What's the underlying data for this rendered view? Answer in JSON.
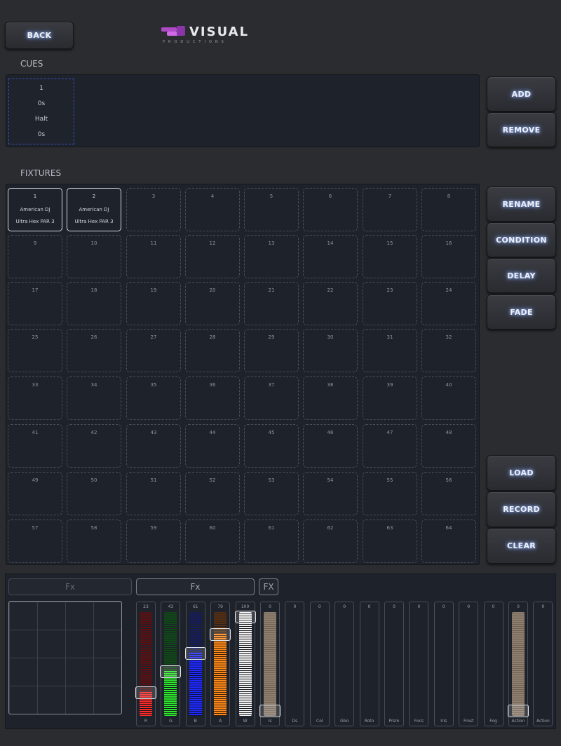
{
  "header": {
    "back_label": "BACK",
    "logo_text": "VISUAL",
    "logo_sub": "PRODUCTIONS"
  },
  "cues": {
    "title": "CUES",
    "items": [
      {
        "number": "1",
        "time": "0s",
        "action": "Halt",
        "fade": "0s"
      }
    ],
    "add_label": "ADD",
    "remove_label": "REMOVE"
  },
  "fixtures": {
    "title": "FIXTURES",
    "actions": [
      "RENAME",
      "CONDITION",
      "DELAY",
      "FADE"
    ],
    "bottom_actions": [
      "LOAD",
      "RECORD",
      "CLEAR"
    ],
    "slots": [
      {
        "number": "1",
        "name": "American DJ",
        "model": "Ultra Hex PAR 3",
        "active": true
      },
      {
        "number": "2",
        "name": "American DJ",
        "model": "Ultra Hex PAR 3",
        "active": true
      },
      {
        "number": "3"
      },
      {
        "number": "4"
      },
      {
        "number": "5"
      },
      {
        "number": "6"
      },
      {
        "number": "7"
      },
      {
        "number": "8"
      },
      {
        "number": "9"
      },
      {
        "number": "10"
      },
      {
        "number": "11"
      },
      {
        "number": "12"
      },
      {
        "number": "13"
      },
      {
        "number": "14"
      },
      {
        "number": "15"
      },
      {
        "number": "16"
      },
      {
        "number": "17"
      },
      {
        "number": "18"
      },
      {
        "number": "19"
      },
      {
        "number": "20"
      },
      {
        "number": "21"
      },
      {
        "number": "22"
      },
      {
        "number": "23"
      },
      {
        "number": "24"
      },
      {
        "number": "25"
      },
      {
        "number": "26"
      },
      {
        "number": "27"
      },
      {
        "number": "28"
      },
      {
        "number": "29"
      },
      {
        "number": "30"
      },
      {
        "number": "31"
      },
      {
        "number": "32"
      },
      {
        "number": "33"
      },
      {
        "number": "34"
      },
      {
        "number": "35"
      },
      {
        "number": "36"
      },
      {
        "number": "37"
      },
      {
        "number": "38"
      },
      {
        "number": "39"
      },
      {
        "number": "40"
      },
      {
        "number": "41"
      },
      {
        "number": "42"
      },
      {
        "number": "43"
      },
      {
        "number": "44"
      },
      {
        "number": "45"
      },
      {
        "number": "46"
      },
      {
        "number": "47"
      },
      {
        "number": "48"
      },
      {
        "number": "49"
      },
      {
        "number": "50"
      },
      {
        "number": "51"
      },
      {
        "number": "52"
      },
      {
        "number": "53"
      },
      {
        "number": "54"
      },
      {
        "number": "55"
      },
      {
        "number": "56"
      },
      {
        "number": "57"
      },
      {
        "number": "58"
      },
      {
        "number": "59"
      },
      {
        "number": "60"
      },
      {
        "number": "61"
      },
      {
        "number": "62"
      },
      {
        "number": "63"
      },
      {
        "number": "64"
      }
    ]
  },
  "fx_tabs": [
    {
      "label": "Fx",
      "active": false
    },
    {
      "label": "Fx",
      "active": true
    },
    {
      "label": "FX",
      "active": true
    }
  ],
  "channels": [
    {
      "label": "R",
      "value": "23",
      "level": 0.23,
      "color": "#ff2a2a",
      "dim": "#5a1012"
    },
    {
      "label": "G",
      "value": "43",
      "level": 0.43,
      "color": "#2bea2b",
      "dim": "#0f4a16"
    },
    {
      "label": "B",
      "value": "61",
      "level": 0.61,
      "color": "#1f2aff",
      "dim": "#151c5a"
    },
    {
      "label": "A",
      "value": "79",
      "level": 0.79,
      "color": "#ff8a1a",
      "dim": "#5a2f10"
    },
    {
      "label": "W",
      "value": "100",
      "level": 1.0,
      "color": "#f2f2f2",
      "dim": "#555555"
    },
    {
      "label": "Is",
      "value": "0",
      "level": 0,
      "color": "#8e7e6e",
      "dim": "#6e6256",
      "ghost": true
    },
    {
      "label": "Ds",
      "value": "0",
      "level": 0,
      "color": "#1e222a",
      "dim": "#1e222a"
    },
    {
      "label": "Col",
      "value": "0",
      "level": 0,
      "color": "#1e222a",
      "dim": "#1e222a"
    },
    {
      "label": "Gbo",
      "value": "0",
      "level": 0,
      "color": "#1e222a",
      "dim": "#1e222a"
    },
    {
      "label": "Rotn",
      "value": "0",
      "level": 0,
      "color": "#1e222a",
      "dim": "#1e222a"
    },
    {
      "label": "Prsm",
      "value": "0",
      "level": 0,
      "color": "#1e222a",
      "dim": "#1e222a"
    },
    {
      "label": "Focs",
      "value": "0",
      "level": 0,
      "color": "#1e222a",
      "dim": "#1e222a"
    },
    {
      "label": "Iris",
      "value": "0",
      "level": 0,
      "color": "#1e222a",
      "dim": "#1e222a"
    },
    {
      "label": "Frost",
      "value": "0",
      "level": 0,
      "color": "#1e222a",
      "dim": "#1e222a"
    },
    {
      "label": "Fog",
      "value": "0",
      "level": 0,
      "color": "#1e222a",
      "dim": "#1e222a"
    },
    {
      "label": "Action",
      "value": "0",
      "level": 0,
      "color": "#8e7e6e",
      "dim": "#6e6256",
      "ghost": true
    },
    {
      "label": "Action",
      "value": "0",
      "level": 0,
      "color": "#1e222a",
      "dim": "#1e222a"
    }
  ]
}
